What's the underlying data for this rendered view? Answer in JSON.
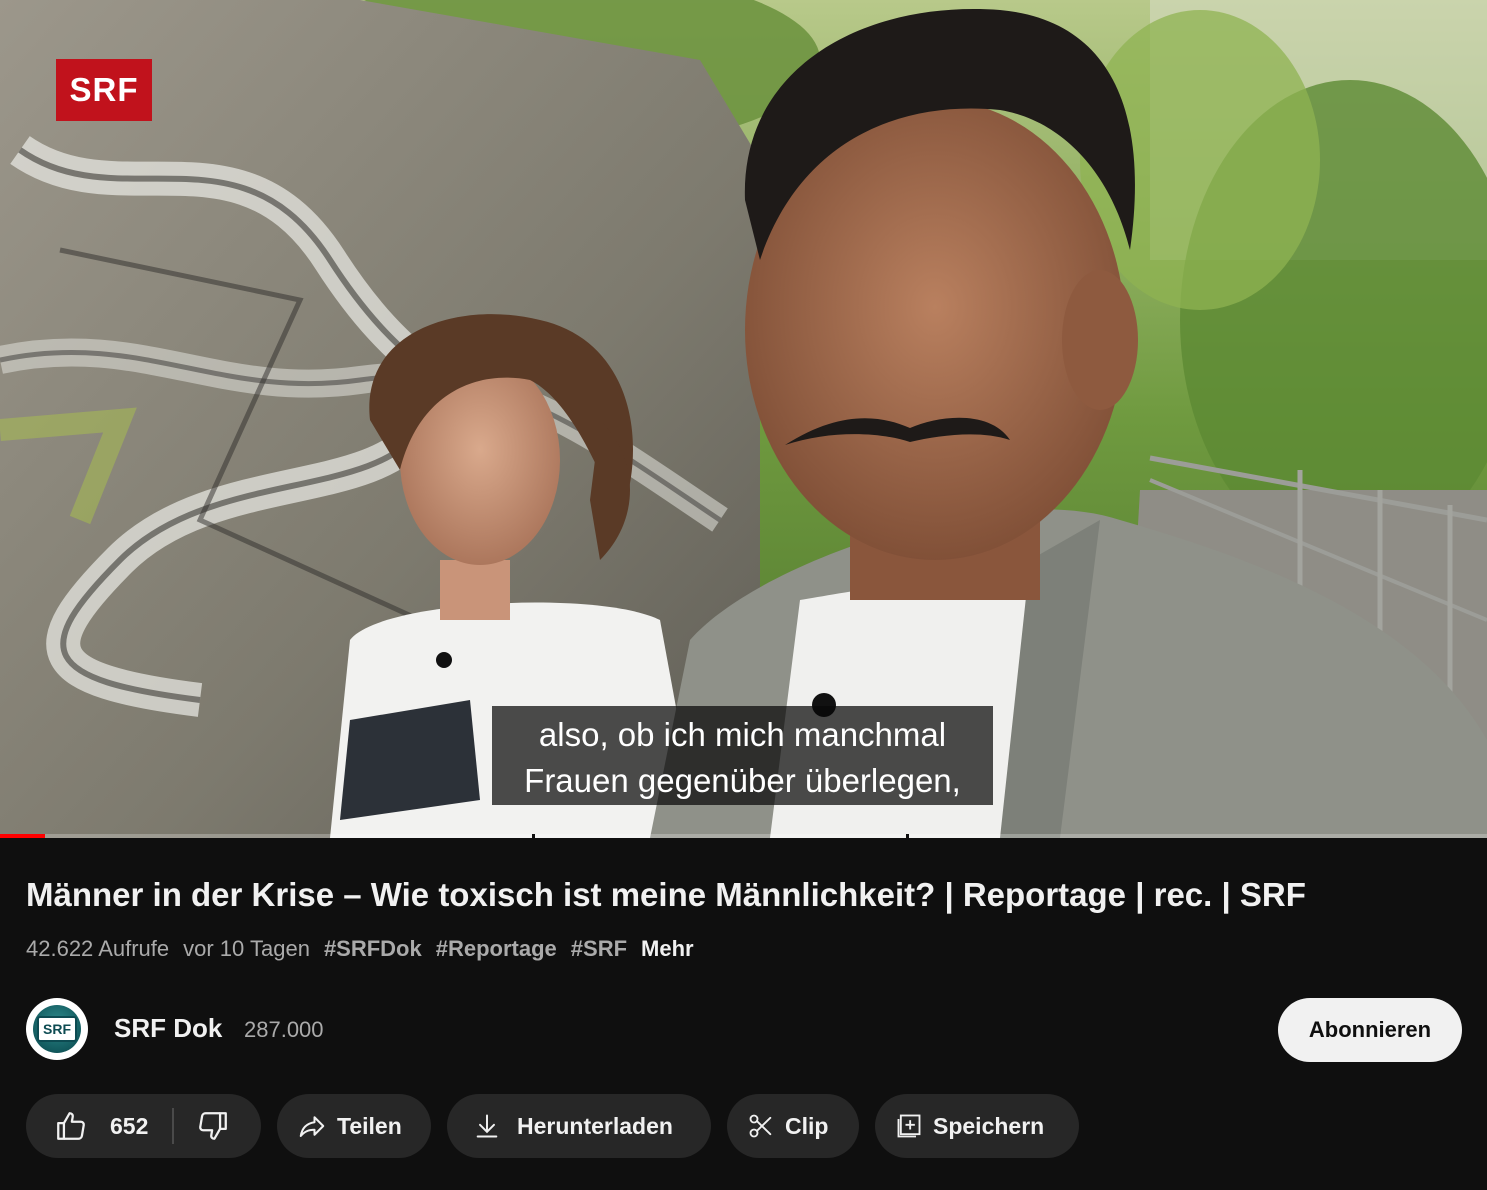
{
  "video": {
    "channel_logo": "SRF",
    "subtitle_line1": "also, ob ich mich manchmal",
    "subtitle_line2": "Frauen gegenüber überlegen,",
    "progress": 0.03
  },
  "title": "Männer in der Krise – Wie toxisch ist meine Männlichkeit? | Reportage | rec. | SRF",
  "meta": {
    "views": "42.622 Aufrufe",
    "age": "vor 10 Tagen",
    "tags": [
      "#SRFDok",
      "#Reportage",
      "#SRF"
    ],
    "more": "Mehr"
  },
  "channel": {
    "avatar_text": "SRF",
    "name": "SRF Dok",
    "subscribers": "287.000",
    "subscribe_label": "Abonnieren"
  },
  "actions": {
    "like_count": "652",
    "share_label": "Teilen",
    "download_label": "Herunterladen",
    "clip_label": "Clip",
    "save_label": "Speichern",
    "icons": [
      "thumbs-up-icon",
      "thumbs-down-icon",
      "share-icon",
      "download-icon",
      "scissors-icon",
      "playlist-add-icon"
    ]
  },
  "colors": {
    "background": "#0f0f0f",
    "pill": "#272727",
    "srf_red": "#c1121c",
    "text_primary": "#f1f1f1",
    "text_secondary": "#aaaaaa"
  }
}
